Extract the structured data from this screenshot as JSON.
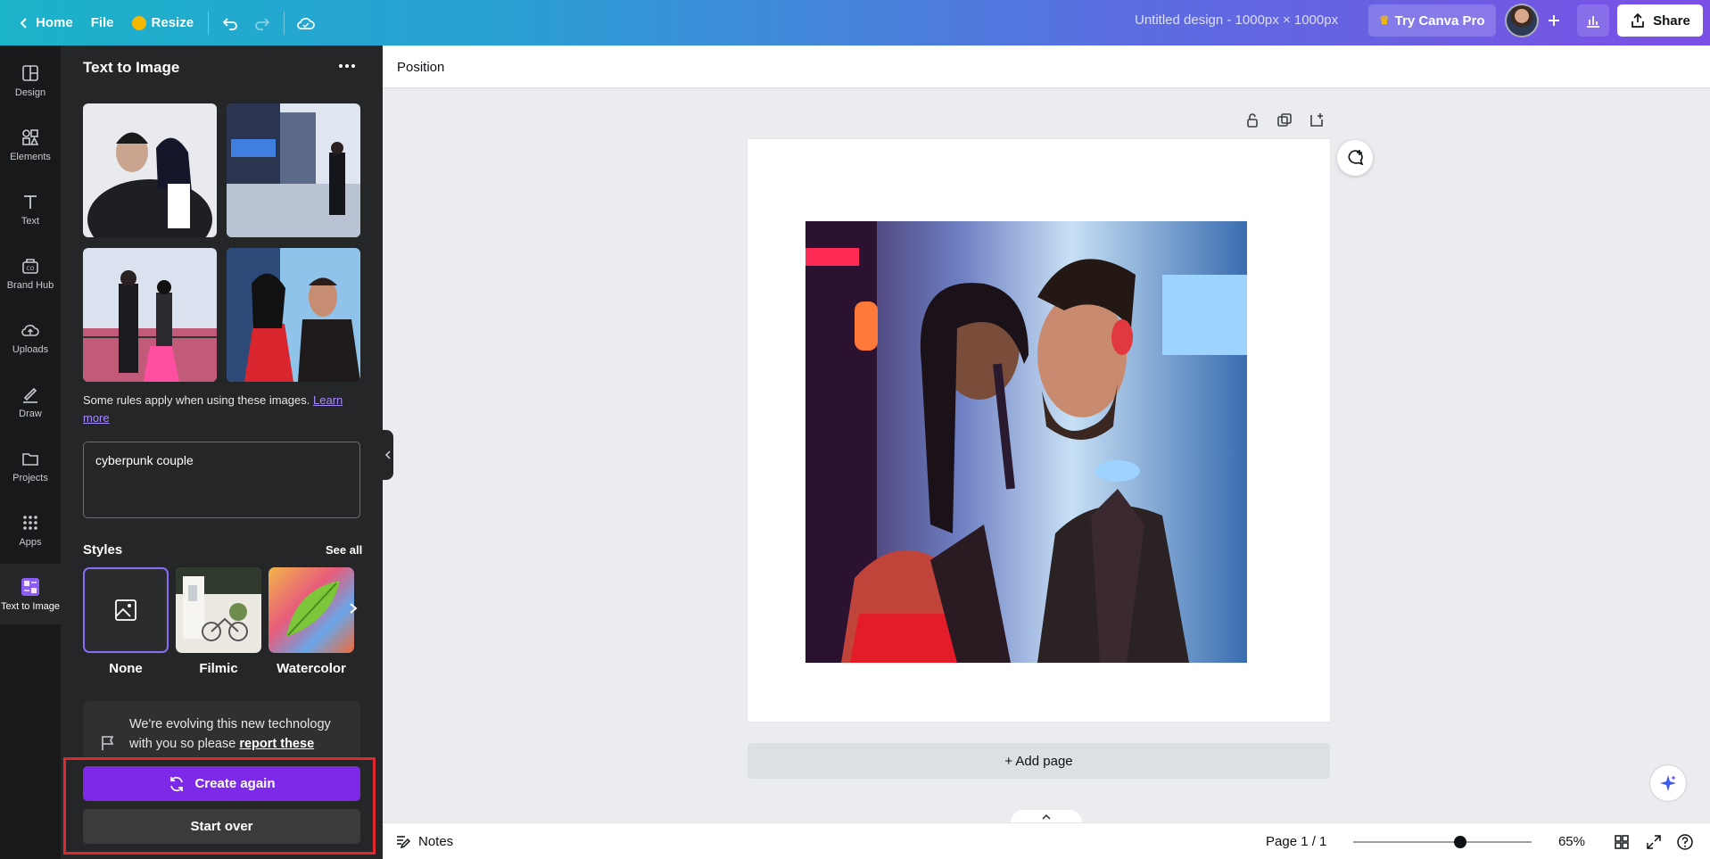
{
  "topbar": {
    "home_label": "Home",
    "file_label": "File",
    "resize_label": "Resize",
    "doc_title": "Untitled design - 1000px × 1000px",
    "try_pro_label": "Try Canva Pro",
    "share_label": "Share"
  },
  "rail": {
    "items": [
      {
        "label": "Design",
        "icon": "layout-icon"
      },
      {
        "label": "Elements",
        "icon": "shapes-icon"
      },
      {
        "label": "Text",
        "icon": "text-icon"
      },
      {
        "label": "Brand Hub",
        "icon": "brand-icon"
      },
      {
        "label": "Uploads",
        "icon": "upload-cloud-icon"
      },
      {
        "label": "Draw",
        "icon": "pen-icon"
      },
      {
        "label": "Projects",
        "icon": "folder-icon"
      },
      {
        "label": "Apps",
        "icon": "grid-icon"
      },
      {
        "label": "Text to Image",
        "icon": "text-to-image-icon"
      }
    ]
  },
  "panel": {
    "title": "Text to Image",
    "rules_text": "Some rules apply when using these images.",
    "learn_more": "Learn more",
    "prompt_value": "cyberpunk couple",
    "styles_label": "Styles",
    "see_all": "See all",
    "styles": [
      {
        "name": "None"
      },
      {
        "name": "Filmic"
      },
      {
        "name": "Watercolor"
      }
    ],
    "notice_text": "We're evolving this new technology with you so please",
    "notice_link": "report these",
    "create_again": "Create again",
    "start_over": "Start over"
  },
  "context_bar": {
    "position_label": "Position"
  },
  "canvas": {
    "add_page": "+ Add page"
  },
  "bottombar": {
    "notes_label": "Notes",
    "page_count": "Page 1 / 1",
    "zoom": "65%",
    "zoom_level": 0.6
  },
  "colors": {
    "accent": "#7d2ae8",
    "highlight": "#e0282e",
    "panel_bg": "#252627",
    "rail_bg": "#18191b"
  }
}
